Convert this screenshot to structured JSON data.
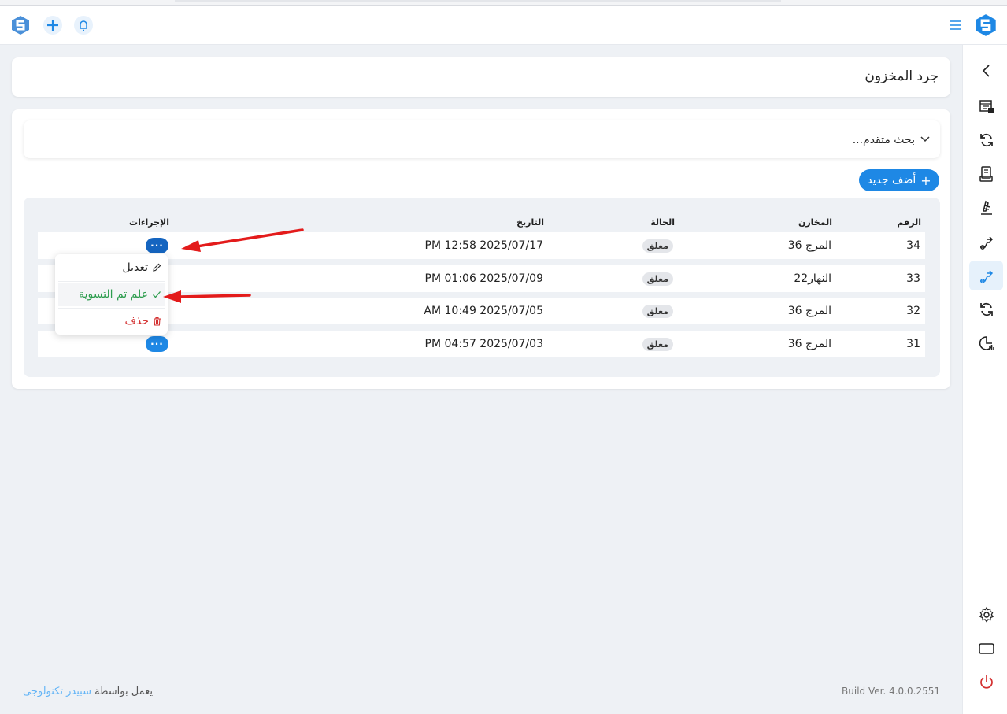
{
  "icons": {
    "logo": "spider-logo-icon",
    "hamburger": "hamburger-menu-icon",
    "plus": "plus-icon",
    "bell": "bell-icon"
  },
  "sidebar": {
    "items": [
      {
        "icon": "chevron-left-icon"
      },
      {
        "icon": "warehouse-icon"
      },
      {
        "icon": "refresh-icon"
      },
      {
        "icon": "scanner-icon"
      },
      {
        "icon": "inventory-scale-icon"
      },
      {
        "icon": "transfer-out-icon"
      },
      {
        "icon": "stock-count-icon",
        "active": true
      },
      {
        "icon": "sync-icon"
      },
      {
        "icon": "report-chart-icon"
      },
      {
        "icon": "settings-icon"
      },
      {
        "icon": "display-icon"
      },
      {
        "icon": "power-icon"
      }
    ]
  },
  "page": {
    "title": "جرد المخزون"
  },
  "search": {
    "advanced_label": "بحث متقدم..."
  },
  "add_button": {
    "label": "أضف جديد"
  },
  "table": {
    "headers": {
      "number": "الرقم",
      "warehouse": "المخازن",
      "status": "الحالة",
      "date": "التاريخ",
      "actions": "الإجراءات"
    },
    "rows": [
      {
        "number": "34",
        "warehouse": "المرج 36",
        "status": "معلق",
        "date": "PM 12:58 2025/07/17"
      },
      {
        "number": "33",
        "warehouse": "النهار22",
        "status": "معلق",
        "date": "PM 01:06 2025/07/09"
      },
      {
        "number": "32",
        "warehouse": "المرج 36",
        "status": "معلق",
        "date": "AM 10:49 2025/07/05"
      },
      {
        "number": "31",
        "warehouse": "المرج 36",
        "status": "معلق",
        "date": "PM 04:57 2025/07/03"
      }
    ],
    "actions_button": "···"
  },
  "action_menu": {
    "edit": "تعديل",
    "mark_settled": "علم تم التسوية",
    "delete": "حذف"
  },
  "footer": {
    "powered_by": "يعمل بواسطة",
    "company": "سبيدر تكنولوجى",
    "build": "Build Ver. 4.0.0.2551"
  },
  "colors": {
    "accent": "#1e88e5",
    "success": "#2e9d4f",
    "danger": "#d32f2f",
    "annotation_arrow": "#e31b1b"
  }
}
